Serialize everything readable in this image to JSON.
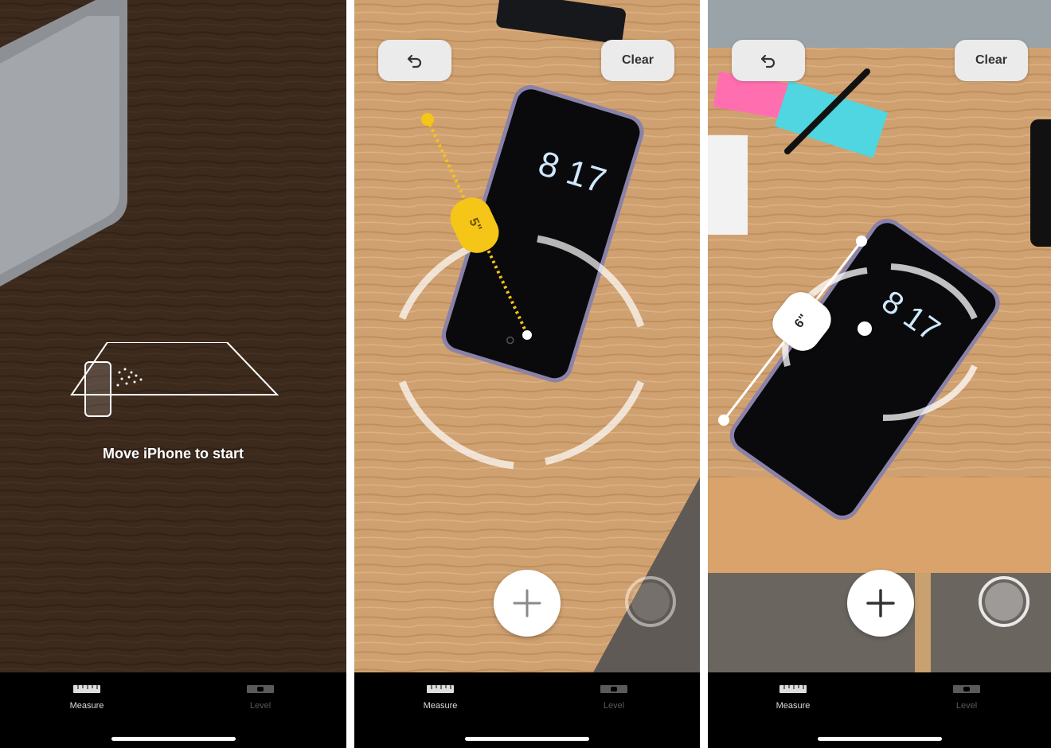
{
  "screens": [
    {
      "id": "onboarding",
      "hint": "Move iPhone to start",
      "tabs": [
        {
          "label": "Measure",
          "icon": "ruler-icon",
          "active": true
        },
        {
          "label": "Level",
          "icon": "level-icon",
          "active": false
        }
      ]
    },
    {
      "id": "measuring",
      "undo_icon": "undo-arrow-icon",
      "clear_label": "Clear",
      "measurement_label": "5\"",
      "phone_clock": "8 17",
      "tabs": [
        {
          "label": "Measure",
          "icon": "ruler-icon",
          "active": true
        },
        {
          "label": "Level",
          "icon": "level-icon",
          "active": false
        }
      ]
    },
    {
      "id": "measured",
      "undo_icon": "undo-arrow-icon",
      "clear_label": "Clear",
      "measurement_label": "6\"",
      "phone_clock": "8 17",
      "tabs": [
        {
          "label": "Measure",
          "icon": "ruler-icon",
          "active": true
        },
        {
          "label": "Level",
          "icon": "level-icon",
          "active": false
        }
      ]
    }
  ],
  "colors": {
    "measure_yellow": "#f5c518",
    "tabbar": "#000000",
    "button_bg": "#ebebeb"
  }
}
